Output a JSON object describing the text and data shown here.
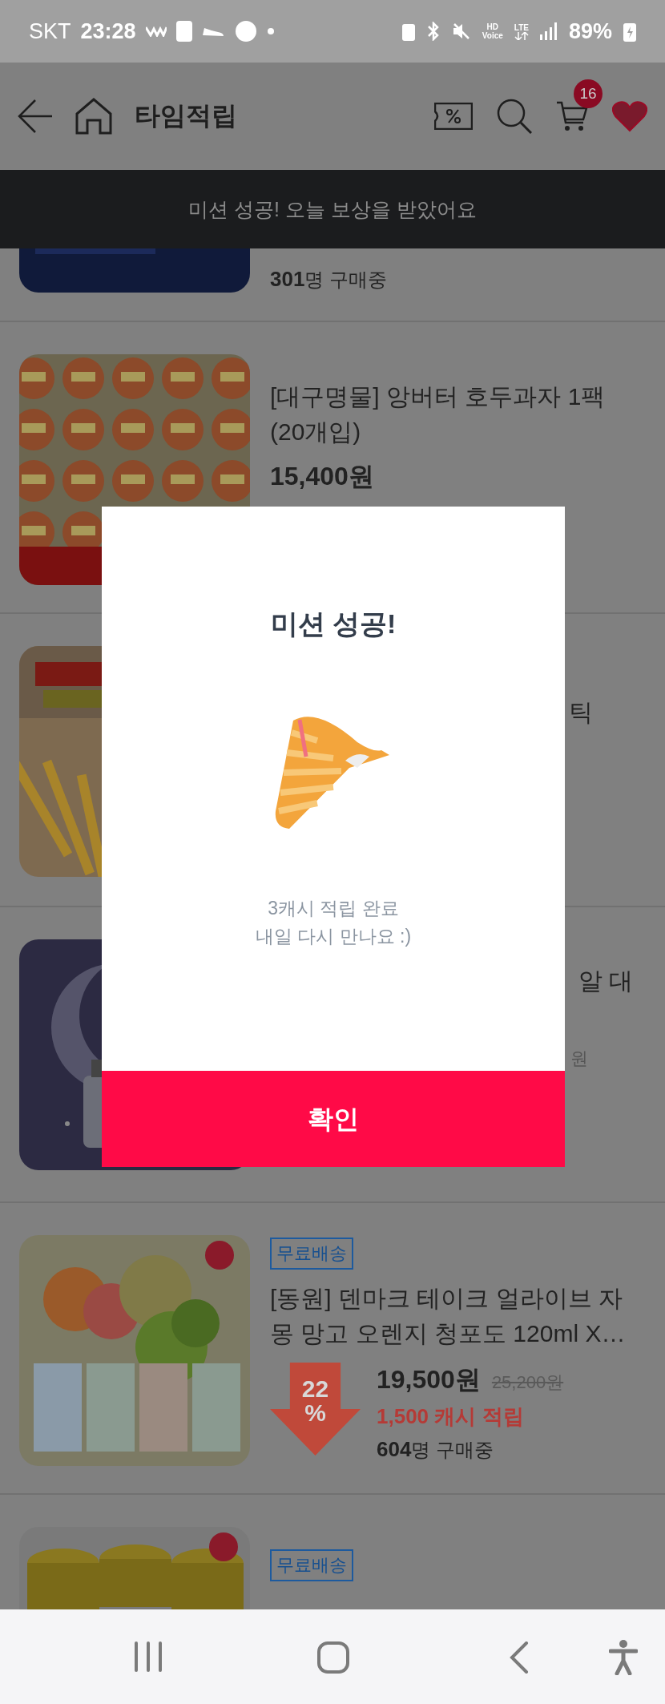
{
  "status_bar": {
    "carrier": "SKT",
    "time": "23:28",
    "hd_top": "HD",
    "hd_bottom": "Voice",
    "network": "LTE",
    "battery": "89%"
  },
  "header": {
    "title": "타임적립",
    "cart_count": "16"
  },
  "toast": {
    "message": "미션 성공! 오늘 보상을 받았어요"
  },
  "products": [
    {
      "kind": "cut_top",
      "buyers": "**301**명 구매중"
    },
    {
      "kind": "full",
      "title_lines": [
        "[대구명물] 앙버터 호두과자 1팩",
        "(20개입)"
      ],
      "price": "15,400원"
    },
    {
      "kind": "covered_badge",
      "title_fragment": "틱"
    },
    {
      "kind": "covered",
      "title_fragment": "알 대",
      "price_fragment": "원"
    },
    {
      "kind": "full",
      "badge": "무료배송",
      "title_lines": [
        "[동원] 덴마크 테이크 얼라이브 자",
        "몽 망고 오렌지 청포도 120ml X…"
      ],
      "discount": "22",
      "discount_unit": "%",
      "price": "19,500원",
      "original_price": "25,200원",
      "cash": "1,500 캐시 적립",
      "buyers": "**604**명 구매중"
    },
    {
      "kind": "cut_bottom",
      "badge": "무료배송"
    }
  ],
  "dialog": {
    "title": "미션 성공!",
    "message_lines": [
      "3캐시 적립 완료",
      "내일 다시 만나요 :)"
    ],
    "confirm": "확인"
  }
}
